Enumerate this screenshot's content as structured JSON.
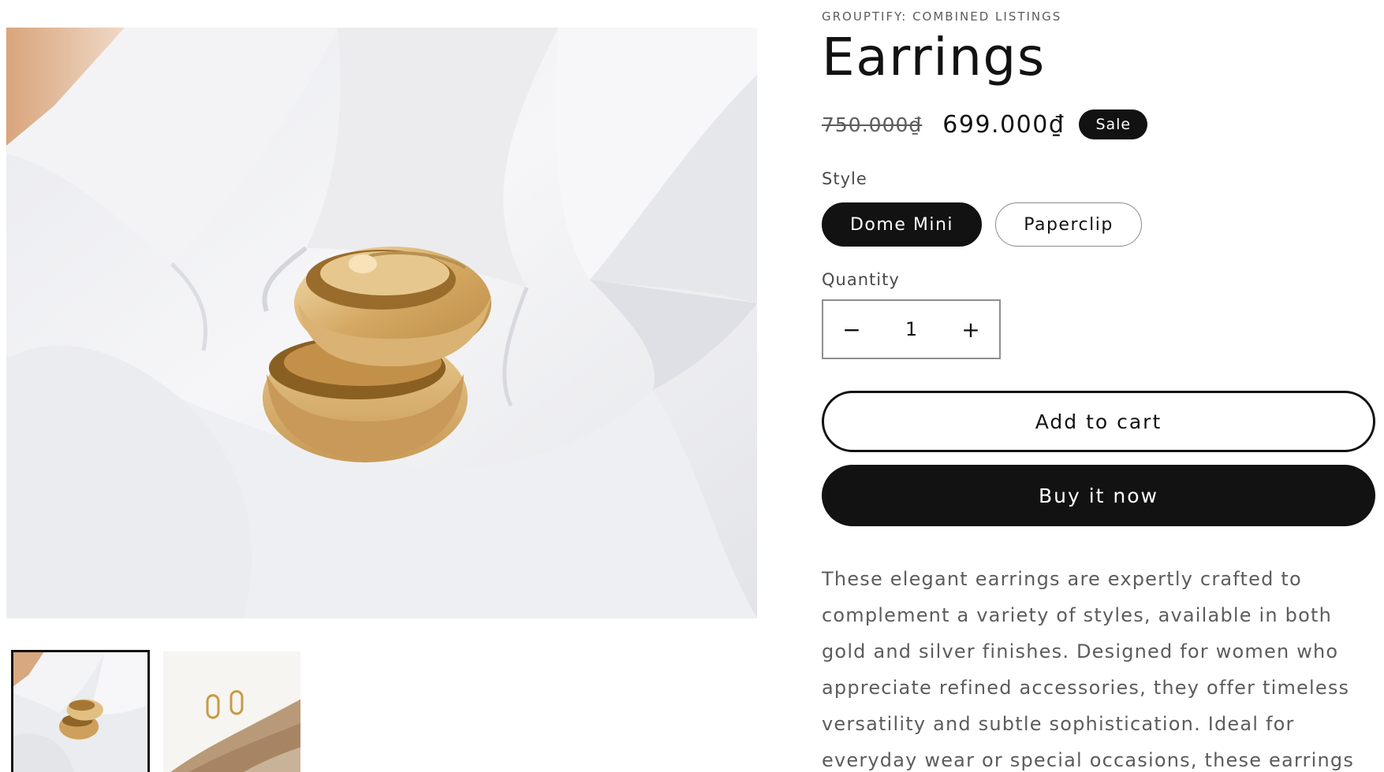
{
  "gallery": {
    "main_image_alt": "Gold dome hoop earrings on white fabric",
    "thumbnails": [
      {
        "alt": "Gold dome hoop earrings on white fabric",
        "selected": true
      },
      {
        "alt": "Gold paperclip earrings on stone",
        "selected": false
      }
    ]
  },
  "product": {
    "vendor": "GROUPTIFY: COMBINED LISTINGS",
    "title": "Earrings",
    "price": {
      "compare_at": "750.000₫",
      "sale": "699.000₫",
      "badge": "Sale"
    },
    "style": {
      "label": "Style",
      "options": [
        "Dome Mini",
        "Paperclip"
      ],
      "selected": "Dome Mini"
    },
    "quantity": {
      "label": "Quantity",
      "value": "1",
      "decrease_symbol": "−",
      "increase_symbol": "+"
    },
    "add_to_cart_label": "Add to cart",
    "buy_now_label": "Buy it now",
    "description": "These elegant earrings are expertly crafted to complement a variety of styles, available in both gold and silver finishes. Designed for women who appreciate refined accessories, they offer timeless versatility and subtle sophistication. Ideal for everyday wear or special occasions, these earrings"
  },
  "icons": {
    "decrease": "minus-icon",
    "increase": "plus-icon"
  },
  "colors": {
    "primary": "#121212",
    "muted_text": "#5c5c5c",
    "background": "#ffffff"
  }
}
